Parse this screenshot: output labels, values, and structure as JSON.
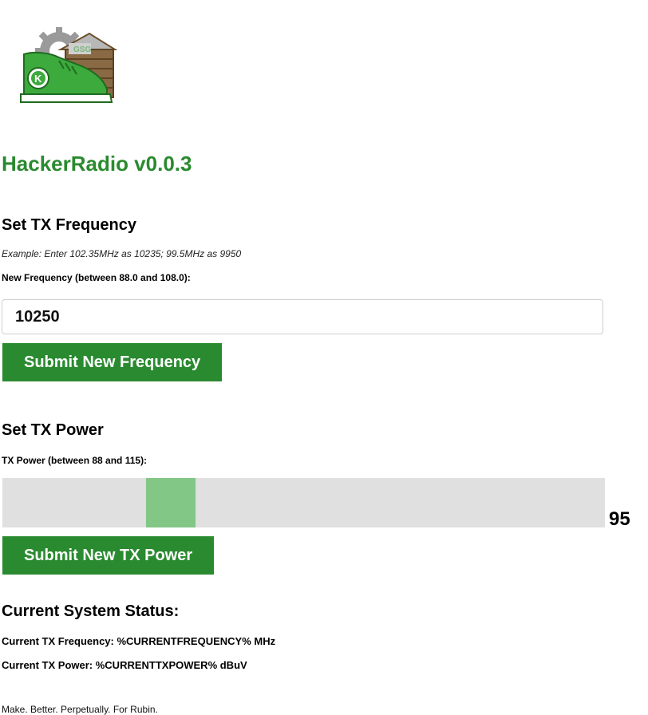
{
  "header": {
    "title": "HackerRadio v0.0.3"
  },
  "frequency": {
    "heading": "Set TX Frequency",
    "example": "Example: Enter 102.35MHz as 10235; 99.5MHz as 9950",
    "label": "New Frequency (between 88.0 and 108.0):",
    "input_value": "10250",
    "submit_label": "Submit New Frequency"
  },
  "power": {
    "heading": "Set TX Power",
    "label": "TX Power (between 88 and 115):",
    "min": 88,
    "max": 115,
    "value": 95,
    "value_display": "95",
    "submit_label": "Submit New TX Power"
  },
  "status": {
    "heading": "Current System Status:",
    "frequency_line": "Current TX Frequency: %CURRENTFREQUENCY% MHz",
    "power_line": "Current TX Power: %CURRENTTXPOWER% dBuV"
  },
  "footer": {
    "text": "Make. Better. Perpetually. For Rubin."
  },
  "colors": {
    "accent": "#2a8a30",
    "slider_thumb": "#82c785",
    "slider_track": "#e0e0e0"
  }
}
